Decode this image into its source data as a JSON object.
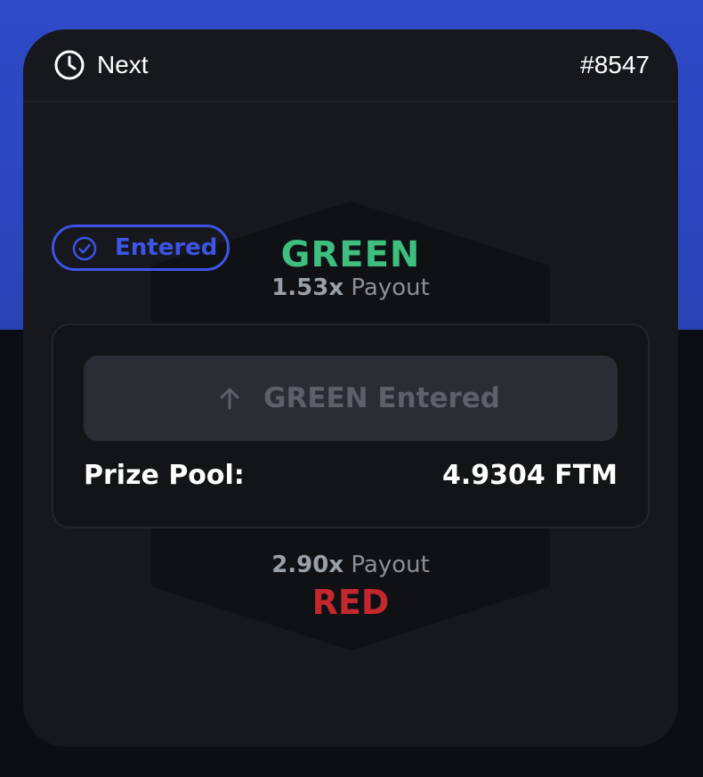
{
  "header": {
    "next_label": "Next",
    "round_id": "#8547"
  },
  "status_badge": {
    "label": "Entered"
  },
  "up": {
    "label": "GREEN",
    "multiplier": "1.53x",
    "payout_word": "Payout"
  },
  "entry_button": {
    "label": "GREEN Entered"
  },
  "prize_pool": {
    "label": "Prize Pool:",
    "value": "4.9304 FTM"
  },
  "down": {
    "label": "RED",
    "multiplier": "2.90x",
    "payout_word": "Payout"
  },
  "colors": {
    "background_top": "#2f4ac7",
    "card": "#16181d",
    "accent": "#3d54e6",
    "green": "#3fbf7f",
    "red": "#c4282f"
  },
  "icons": {
    "header_icon": "clock-icon",
    "badge_icon": "check-circle-icon",
    "button_icon": "arrow-up-icon"
  }
}
